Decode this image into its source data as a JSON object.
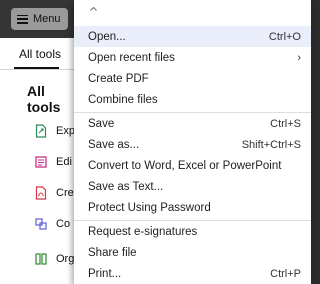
{
  "topbar": {
    "menu_label": "Menu"
  },
  "left_panel": {
    "tab_label": "All tools",
    "heading": "All tools",
    "tools": [
      {
        "label": "Exp",
        "icon": "export-pdf-icon",
        "color": "#2e8a5c"
      },
      {
        "label": "Edi",
        "icon": "edit-pdf-icon",
        "color": "#c2237b"
      },
      {
        "label": "Cre",
        "icon": "create-pdf-icon",
        "color": "#d7373f"
      },
      {
        "label": "Co",
        "icon": "combine-files-icon",
        "color": "#5c5ce0"
      },
      {
        "label": "Org",
        "icon": "organize-pages-icon",
        "color": "#2e8a2e"
      }
    ]
  },
  "menu": {
    "items": [
      {
        "label": "Open...",
        "shortcut": "Ctrl+O"
      },
      {
        "label": "Open recent files",
        "submenu": "›"
      },
      {
        "label": "Create PDF"
      },
      {
        "label": "Combine files"
      },
      {
        "label": "Save",
        "shortcut": "Ctrl+S"
      },
      {
        "label": "Save as...",
        "shortcut": "Shift+Ctrl+S"
      },
      {
        "label": "Convert to Word, Excel or PowerPoint"
      },
      {
        "label": "Save as Text..."
      },
      {
        "label": "Protect Using Password"
      },
      {
        "label": "Request e-signatures"
      },
      {
        "label": "Share file"
      },
      {
        "label": "Print...",
        "shortcut": "Ctrl+P"
      }
    ]
  }
}
